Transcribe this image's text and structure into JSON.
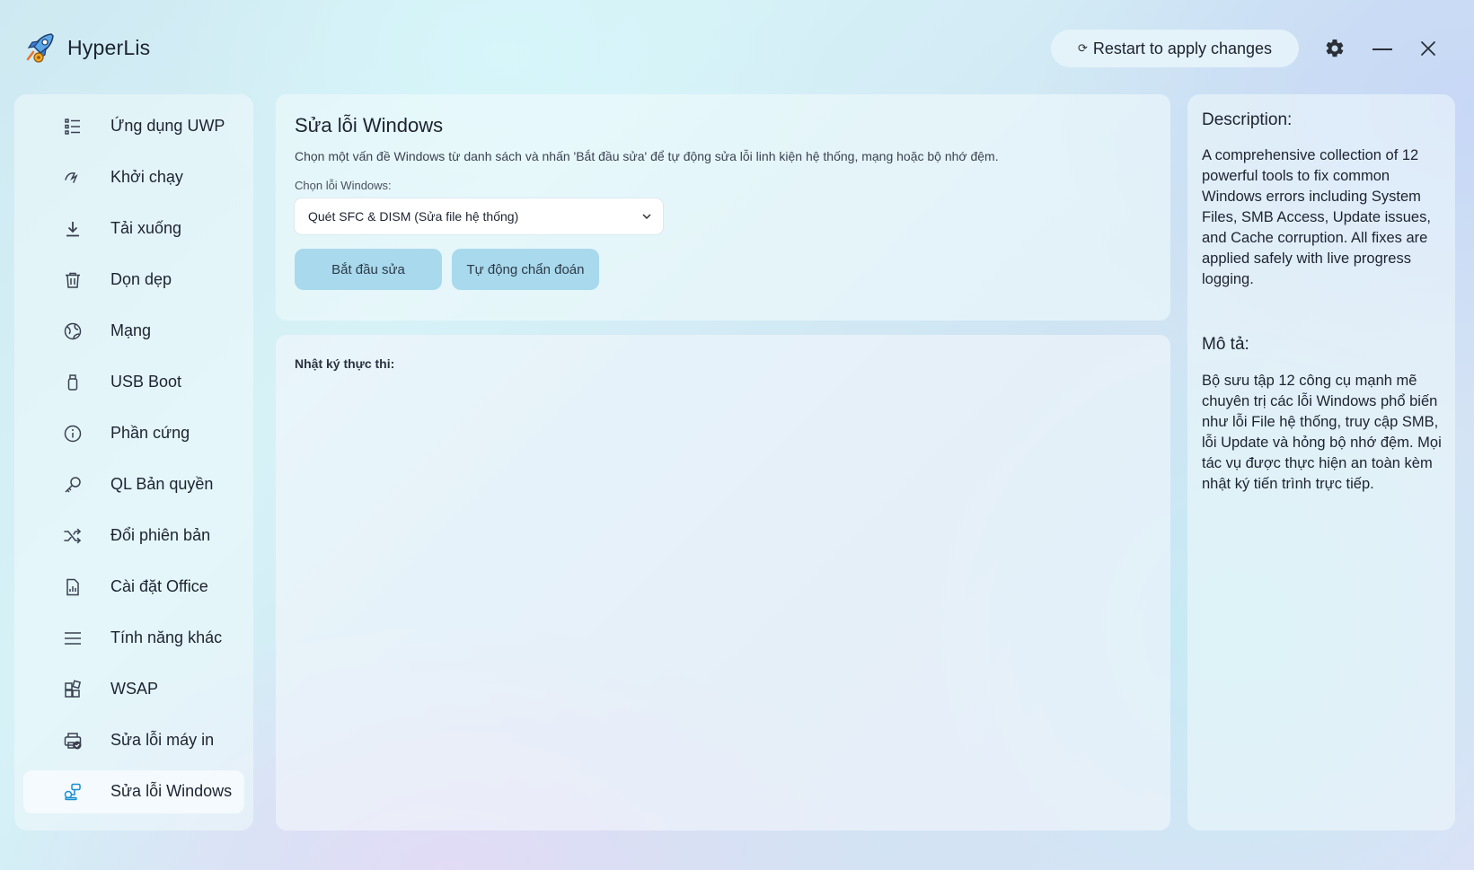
{
  "app": {
    "title": "HyperLis",
    "restart_label": "Restart to apply changes"
  },
  "sidebar": {
    "items": [
      {
        "label": "Ứng dụng UWP",
        "icon": "list-icon"
      },
      {
        "label": "Khởi chạy",
        "icon": "startup-icon"
      },
      {
        "label": "Tải xuống",
        "icon": "download-icon"
      },
      {
        "label": "Dọn dẹp",
        "icon": "trash-icon"
      },
      {
        "label": "Mạng",
        "icon": "globe-icon"
      },
      {
        "label": "USB Boot",
        "icon": "usb-icon"
      },
      {
        "label": "Phần cứng",
        "icon": "info-icon"
      },
      {
        "label": "QL Bản quyền",
        "icon": "key-icon"
      },
      {
        "label": "Đổi phiên bản",
        "icon": "shuffle-icon"
      },
      {
        "label": "Cài đặt Office",
        "icon": "office-icon"
      },
      {
        "label": "Tính năng khác",
        "icon": "menu-icon"
      },
      {
        "label": "WSAP",
        "icon": "apps-icon"
      },
      {
        "label": "Sửa lỗi máy in",
        "icon": "printer-icon"
      },
      {
        "label": "Sửa lỗi Windows",
        "icon": "windows-fix-icon",
        "active": true
      }
    ]
  },
  "main": {
    "title": "Sửa lỗi Windows",
    "description": "Chọn một vấn đề Windows từ danh sách và nhấn 'Bắt đầu sửa' để tự động sửa lỗi linh kiện hệ thống, mạng hoặc bộ nhớ đệm.",
    "select_label": "Chọn lỗi Windows:",
    "selected_option": "Quét SFC & DISM (Sửa file hệ thống)",
    "start_button": "Bắt đầu sửa",
    "auto_button": "Tự động chẩn đoán",
    "log_label": "Nhật ký thực thi:"
  },
  "right_panel": {
    "desc_heading": "Description:",
    "desc_text": "A comprehensive collection of 12 powerful tools to fix common Windows errors including System Files, SMB Access, Update issues, and Cache corruption. All fixes are applied safely with live progress logging.",
    "mota_heading": "Mô tả:",
    "mota_text": "Bộ sưu tập 12 công cụ mạnh mẽ chuyên trị các lỗi Windows phổ biến như lỗi File hệ thống, truy cập SMB, lỗi Update và hỏng bộ nhớ đệm. Mọi tác vụ được thực hiện an toàn kèm nhật ký tiến trình trực tiếp."
  },
  "colors": {
    "button_bg": "#a8d9ec",
    "accent": "#1a8fd1"
  }
}
